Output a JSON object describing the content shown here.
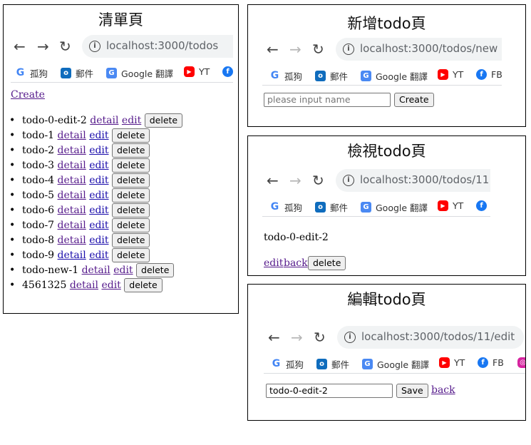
{
  "list_panel": {
    "title": "清單頁",
    "url": "localhost:3000/todos",
    "create_label": "Create",
    "todos": [
      {
        "name": "todo-0-edit-2"
      },
      {
        "name": "todo-1"
      },
      {
        "name": "todo-2"
      },
      {
        "name": "todo-3"
      },
      {
        "name": "todo-4"
      },
      {
        "name": "todo-5"
      },
      {
        "name": "todo-6"
      },
      {
        "name": "todo-7"
      },
      {
        "name": "todo-8"
      },
      {
        "name": "todo-9"
      },
      {
        "name": "todo-new-1"
      },
      {
        "name": "4561325"
      }
    ],
    "detail_label": "detail",
    "edit_label": "edit",
    "delete_label": "delete"
  },
  "new_panel": {
    "title": "新增todo頁",
    "url": "localhost:3000/todos/new",
    "input_placeholder": "please input name",
    "create_button": "Create"
  },
  "view_panel": {
    "title": "檢視todo頁",
    "url": "localhost:3000/todos/11",
    "todo_name": "todo-0-edit-2",
    "edit_label": "edit",
    "back_label": "back",
    "delete_label": "delete"
  },
  "edit_panel": {
    "title": "編輯todo頁",
    "url": "localhost:3000/todos/11/edit",
    "input_value": "todo-0-edit-2",
    "save_button": "Save",
    "back_label": "back"
  },
  "bookmarks": {
    "gouguo": "孤狗",
    "mail": "郵件",
    "translate": "Google 翻譯",
    "yt": "YT",
    "fb": "FB"
  },
  "icons": {
    "back": "arrow-left-icon",
    "forward": "arrow-right-icon",
    "reload": "reload-icon",
    "info": "info-icon"
  }
}
